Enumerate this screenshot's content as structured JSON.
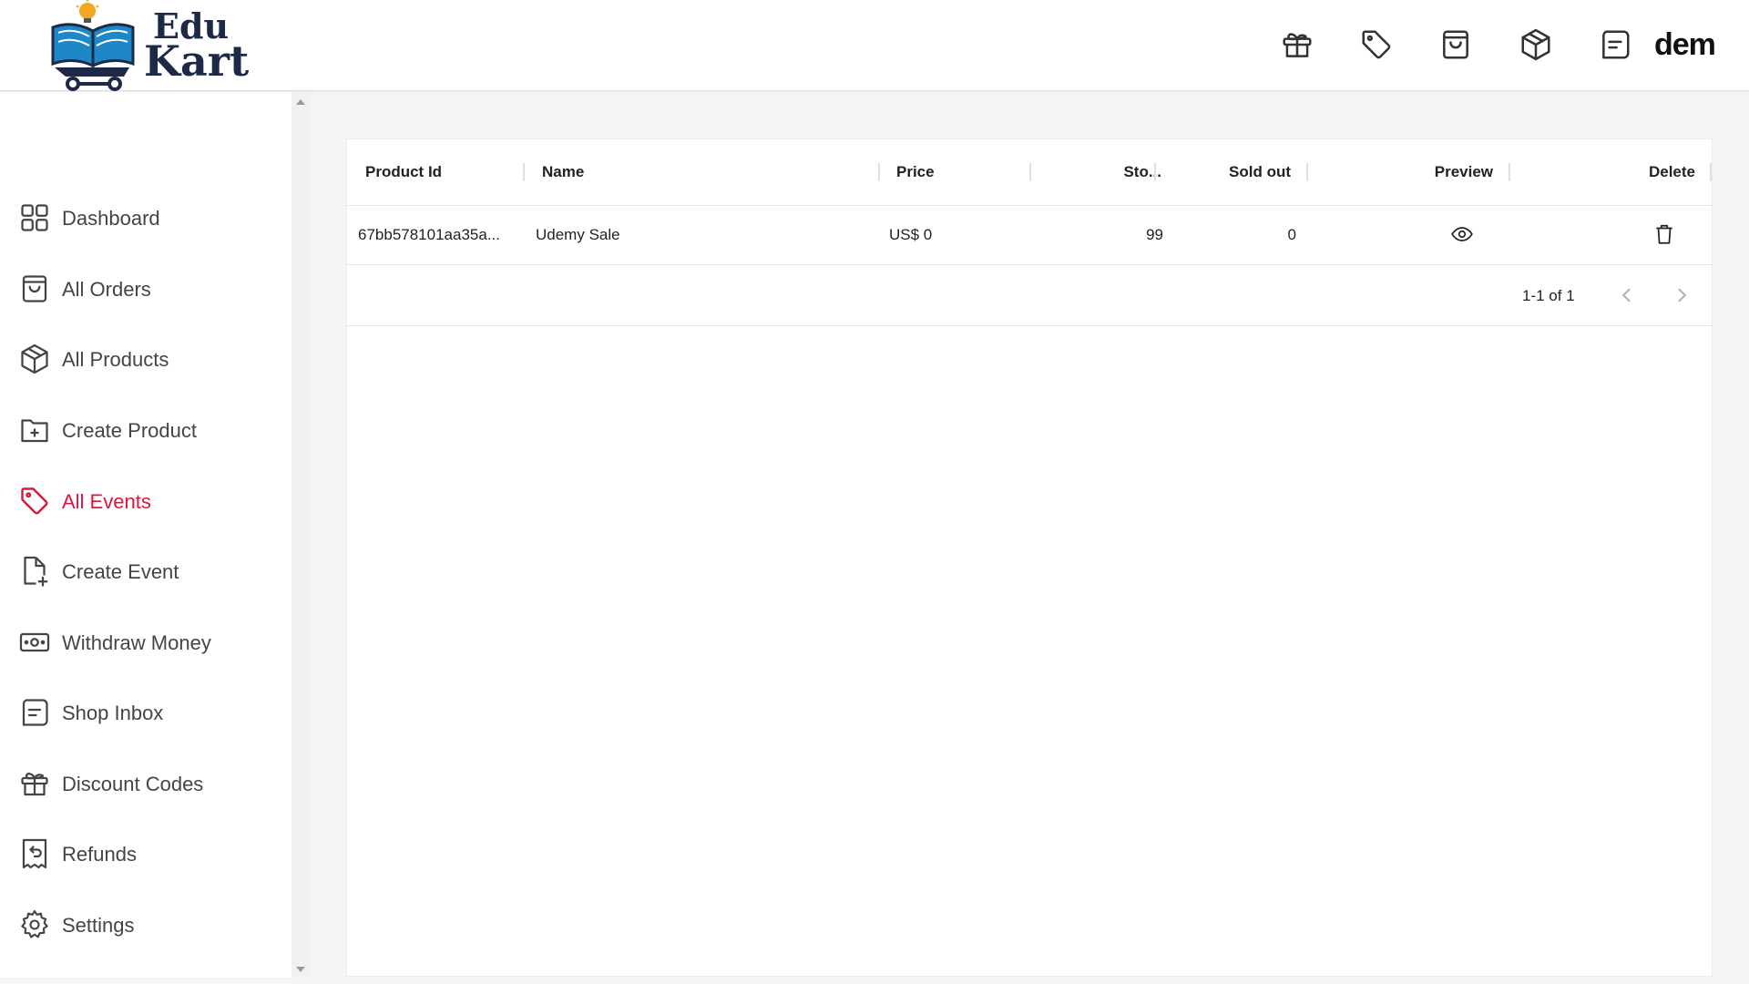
{
  "brand": {
    "line1": "Edu",
    "line2": "Kart"
  },
  "header": {
    "icons": [
      "gift-icon",
      "tag-icon",
      "shopping-bag-icon",
      "package-icon",
      "message-icon"
    ],
    "user_text": "dem"
  },
  "sidebar": {
    "items": [
      {
        "label": "Dashboard",
        "icon": "dashboard-grid-icon"
      },
      {
        "label": "All Orders",
        "icon": "shopping-bag-icon"
      },
      {
        "label": "All Products",
        "icon": "package-icon"
      },
      {
        "label": "Create Product",
        "icon": "folder-plus-icon"
      },
      {
        "label": "All Events",
        "icon": "tag-icon"
      },
      {
        "label": "Create Event",
        "icon": "file-plus-icon"
      },
      {
        "label": "Withdraw Money",
        "icon": "banknote-icon"
      },
      {
        "label": "Shop Inbox",
        "icon": "message-icon"
      },
      {
        "label": "Discount Codes",
        "icon": "gift-icon"
      },
      {
        "label": "Refunds",
        "icon": "receipt-refund-icon"
      },
      {
        "label": "Settings",
        "icon": "gear-icon"
      }
    ],
    "active_index": 4
  },
  "table": {
    "columns": [
      "Product Id",
      "Name",
      "Price",
      "Sto...",
      "Sold out",
      "Preview",
      "Delete"
    ],
    "rows": [
      {
        "product_id": "67bb578101aa35a...",
        "name": "Udemy Sale",
        "price": "US$ 0",
        "stock": "99",
        "sold_out": "0",
        "preview_icon": "eye-icon",
        "delete_icon": "trash-icon"
      }
    ],
    "pagination": "1-1 of 1"
  },
  "colors": {
    "accent": "#e0143c",
    "text": "#444444",
    "brand_dark": "#1c2a48",
    "brand_blue": "#1e88c7"
  }
}
